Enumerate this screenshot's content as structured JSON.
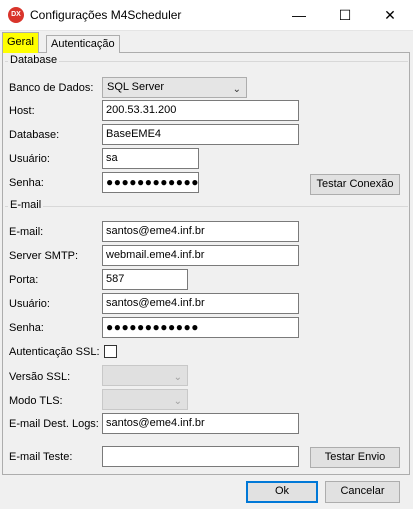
{
  "window": {
    "icon_text": "DX",
    "title": "Configurações M4Scheduler",
    "minimize_glyph": "—",
    "maximize_glyph": "☐",
    "close_glyph": "✕"
  },
  "tabs": [
    {
      "label": "Geral",
      "active": true
    },
    {
      "label": "Autenticação",
      "active": false
    }
  ],
  "database": {
    "group_title": "Database",
    "db_type_label": "Banco de Dados:",
    "db_type_value": "SQL Server",
    "host_label": "Host:",
    "host_value": "200.53.31.200",
    "database_label": "Database:",
    "database_value": "BaseEME4",
    "user_label": "Usuário:",
    "user_value": "sa",
    "password_label": "Senha:",
    "password_value": "●●●●●●●●●●●●●",
    "test_button": "Testar Conexão"
  },
  "email": {
    "group_title": "E-mail",
    "email_label": "E-mail:",
    "email_value": "santos@eme4.inf.br",
    "smtp_label": "Server SMTP:",
    "smtp_value": "webmail.eme4.inf.br",
    "port_label": "Porta:",
    "port_value": "587",
    "user_label": "Usuário:",
    "user_value": "santos@eme4.inf.br",
    "password_label": "Senha:",
    "password_value": "●●●●●●●●●●●●",
    "ssl_label": "Autenticação SSL:",
    "ssl_checked": false,
    "ssl_version_label": "Versão SSL:",
    "tls_mode_label": "Modo TLS:",
    "dest_logs_label": "E-mail Dest. Logs:",
    "dest_logs_value": "santos@eme4.inf.br",
    "test_email_label": "E-mail Teste:",
    "test_email_value": "",
    "test_button": "Testar Envio"
  },
  "footer": {
    "ok_label": "Ok",
    "cancel_label": "Cancelar"
  },
  "colors": {
    "active_tab": "#ffff00",
    "app_icon": "#d9342b",
    "default_button_border": "#0078d7"
  }
}
